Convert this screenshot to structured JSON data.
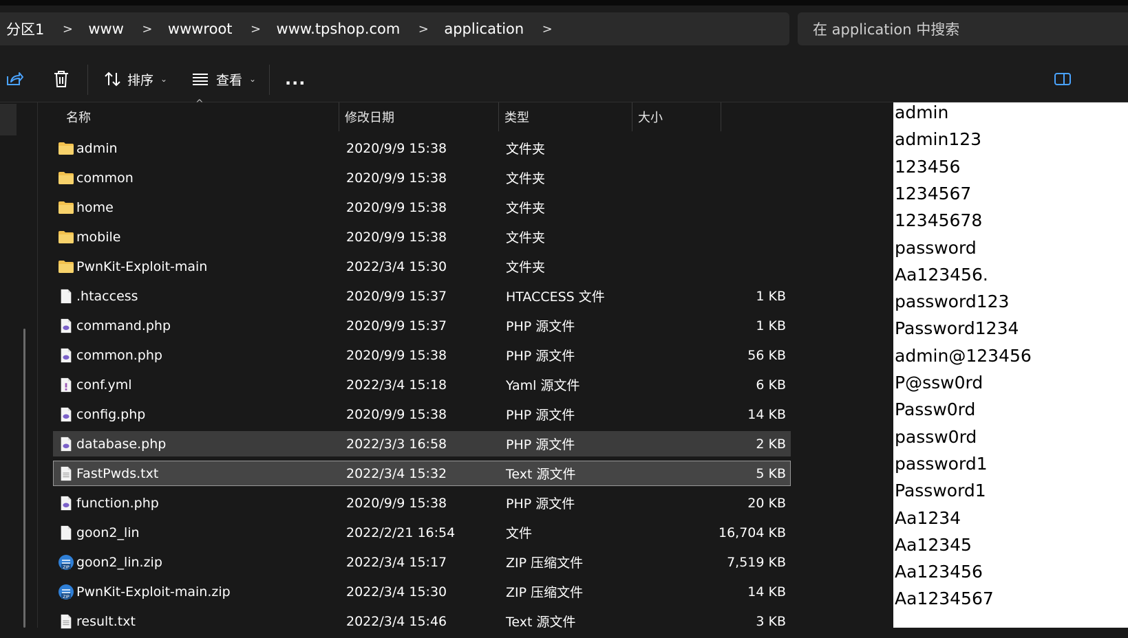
{
  "breadcrumb": {
    "items": [
      "分区1",
      "www",
      "wwwroot",
      "www.tpshop.com",
      "application"
    ],
    "separator": ">"
  },
  "search": {
    "placeholder": "在 application 中搜索"
  },
  "toolbar": {
    "sort_label": "排序",
    "view_label": "查看",
    "more_label": "..."
  },
  "columns": {
    "name": "名称",
    "date": "修改日期",
    "type": "类型",
    "size": "大小"
  },
  "files": [
    {
      "name": "admin",
      "date": "2020/9/9 15:38",
      "type": "文件夹",
      "size": "",
      "icon": "folder-icon"
    },
    {
      "name": "common",
      "date": "2020/9/9 15:38",
      "type": "文件夹",
      "size": "",
      "icon": "folder-icon"
    },
    {
      "name": "home",
      "date": "2020/9/9 15:38",
      "type": "文件夹",
      "size": "",
      "icon": "folder-icon"
    },
    {
      "name": "mobile",
      "date": "2020/9/9 15:38",
      "type": "文件夹",
      "size": "",
      "icon": "folder-icon"
    },
    {
      "name": "PwnKit-Exploit-main",
      "date": "2022/3/4 15:30",
      "type": "文件夹",
      "size": "",
      "icon": "folder-icon"
    },
    {
      "name": ".htaccess",
      "date": "2020/9/9 15:37",
      "type": "HTACCESS 文件",
      "size": "1 KB",
      "icon": "file-icon"
    },
    {
      "name": "command.php",
      "date": "2020/9/9 15:37",
      "type": "PHP 源文件",
      "size": "1 KB",
      "icon": "php-file-icon"
    },
    {
      "name": "common.php",
      "date": "2020/9/9 15:38",
      "type": "PHP 源文件",
      "size": "56 KB",
      "icon": "php-file-icon"
    },
    {
      "name": "conf.yml",
      "date": "2022/3/4 15:18",
      "type": "Yaml 源文件",
      "size": "6 KB",
      "icon": "yaml-file-icon"
    },
    {
      "name": "config.php",
      "date": "2020/9/9 15:38",
      "type": "PHP 源文件",
      "size": "14 KB",
      "icon": "php-file-icon"
    },
    {
      "name": "database.php",
      "date": "2022/3/3 16:58",
      "type": "PHP 源文件",
      "size": "2 KB",
      "icon": "php-file-icon"
    },
    {
      "name": "FastPwds.txt",
      "date": "2022/3/4 15:32",
      "type": "Text 源文件",
      "size": "5 KB",
      "icon": "text-file-icon"
    },
    {
      "name": "function.php",
      "date": "2020/9/9 15:38",
      "type": "PHP 源文件",
      "size": "20 KB",
      "icon": "php-file-icon"
    },
    {
      "name": "goon2_lin",
      "date": "2022/2/21 16:54",
      "type": "文件",
      "size": "16,704 KB",
      "icon": "file-icon"
    },
    {
      "name": "goon2_lin.zip",
      "date": "2022/3/4 15:17",
      "type": "ZIP 压缩文件",
      "size": "7,519 KB",
      "icon": "zip-file-icon"
    },
    {
      "name": "PwnKit-Exploit-main.zip",
      "date": "2022/3/4 15:30",
      "type": "ZIP 压缩文件",
      "size": "14 KB",
      "icon": "zip-file-icon"
    },
    {
      "name": "result.txt",
      "date": "2022/3/4 15:46",
      "type": "Text 源文件",
      "size": "3 KB",
      "icon": "text-file-icon"
    }
  ],
  "preview_lines": [
    "admin",
    "admin123",
    "123456",
    "1234567",
    "12345678",
    "password",
    "Aa123456.",
    "password123",
    "Password1234",
    "admin@123456",
    "P@ssw0rd",
    "Passw0rd",
    "passw0rd",
    "password1",
    "Password1",
    "Aa1234",
    "Aa12345",
    "Aa123456",
    "Aa1234567"
  ],
  "colors": {
    "folder": "#f2c14e",
    "php": "#7b61c9",
    "zip": "#2f7fd6",
    "yaml": "#9b59b6"
  }
}
